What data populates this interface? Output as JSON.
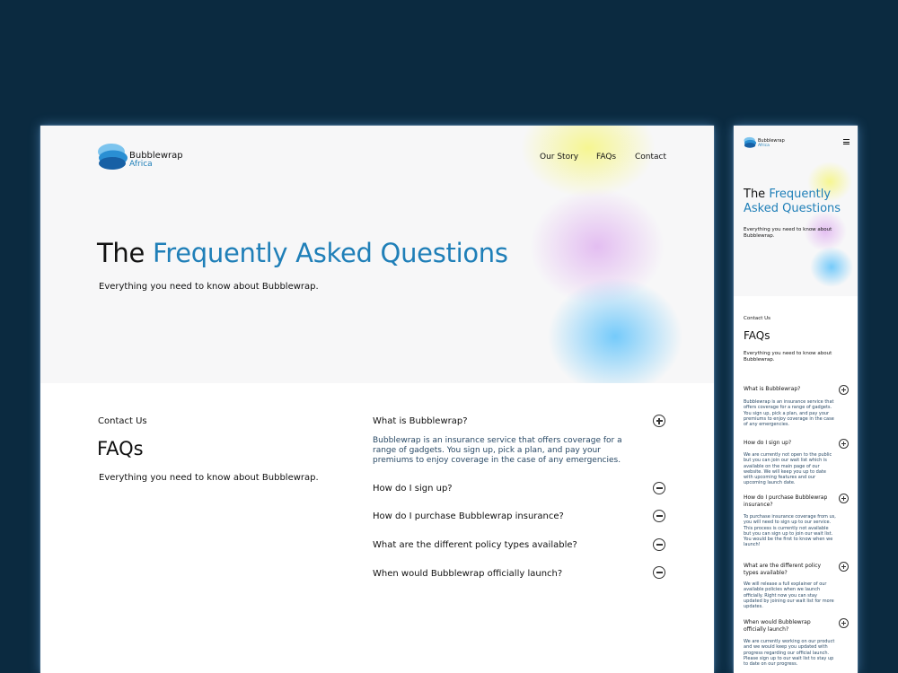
{
  "brand": {
    "name_line1": "Bubblewrap",
    "name_line2": "Africa"
  },
  "nav": {
    "items": [
      "Our Story",
      "FAQs",
      "Contact"
    ]
  },
  "hero": {
    "title_prefix": "The",
    "title_line1": "The",
    "title_accent_desktop": "Frequently Asked Questions",
    "title_accent_m1": "Frequently",
    "title_accent_m2": "Asked Questions",
    "subtitle": "Everything you need to know about Bubblewrap.",
    "subtitle_m1": "Everything you need to know about",
    "subtitle_m2": "Bubblewrap."
  },
  "faq_section": {
    "eyebrow": "Contact Us",
    "heading": "FAQs",
    "description": "Everything you need to know about Bubblewrap.",
    "desc_m1": "Everything you need to know about",
    "desc_m2": "Bubblewrap."
  },
  "faqs_desktop": [
    {
      "question": "What is Bubblewrap?",
      "answer": "Bubblewrap is an insurance service that offers coverage for a range of gadgets. You sign up, pick a plan, and pay your premiums to enjoy coverage in the case of any emergencies.",
      "state": "expanded"
    },
    {
      "question": "How do I sign up?",
      "state": "collapsed"
    },
    {
      "question": "How do I purchase Bubblewrap insurance?",
      "state": "collapsed"
    },
    {
      "question": "What are the different policy types available?",
      "state": "collapsed"
    },
    {
      "question": "When would Bubblewrap officially launch?",
      "state": "collapsed"
    }
  ],
  "faqs_mobile": [
    {
      "question": "What is Bubblewrap?",
      "answer": "Bubblewrap is an insurance service that offers coverage for a range of gadgets. You sign up, pick a plan, and pay your premiums to enjoy coverage in the case of any emergencies."
    },
    {
      "question": "How do I sign up?",
      "answer": "We are currently not open to the public but you can join our wait list which is available on the main page of our website. We will keep you up to date with upcoming features and our upcoming launch date."
    },
    {
      "question": "How do I purchase Bubblewrap insurance?",
      "answer": "To purchase insurance coverage from us, you will need to sign up to our service. This process is currently not available but you can sign up to join our wait list. You would be the first to know when we launch!"
    },
    {
      "question": "What are the different policy types available?",
      "answer": "We will release a full explainer of our available policies when we launch officially. Right now you can stay updated by joining our wait list for more updates."
    },
    {
      "question": "When would Bubblewrap officially launch?",
      "answer": "We are currently working on our product and we would keep you updated with progress regarding our official launch. Please sign up to our wait list to stay up to date on our progress."
    }
  ],
  "colors": {
    "background": "#0b2a40",
    "accent": "#1f7fb8",
    "hero_bg": "#f7f7f8"
  },
  "icons": {
    "expand": "plus-circle-icon",
    "collapse": "minus-circle-icon",
    "menu": "hamburger-menu-icon"
  }
}
